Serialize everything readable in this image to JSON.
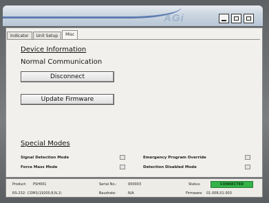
{
  "window": {
    "logo": "AGi",
    "controls": [
      "minimize",
      "restore",
      "close"
    ]
  },
  "tabs": [
    {
      "label": "Indicator",
      "active": false
    },
    {
      "label": "Unit Setup",
      "active": false
    },
    {
      "label": "Misc",
      "active": true
    }
  ],
  "device_info": {
    "heading": "Device Information",
    "status": "Normal Communication",
    "disconnect_label": "Disconnect",
    "update_label": "Update Firmware"
  },
  "special_modes": {
    "heading": "Special Modes",
    "items": [
      {
        "label": "Signal Detection Mode",
        "checked": false
      },
      {
        "label": "Emergency Program Override",
        "checked": false
      },
      {
        "label": "Force Mass Mode",
        "checked": false
      },
      {
        "label": "Detection Disabled Mode",
        "checked": false
      }
    ]
  },
  "footer": {
    "product_label": "Product:",
    "product_value": "PSH001",
    "serial_label": "Serial No.:",
    "serial_value": "000003",
    "status_label": "Status:",
    "status_value": "CONNECTED",
    "status_color": "#34b34a",
    "port_label": "RS-232:",
    "port_value": "COM1(19200,8,N,1)",
    "baud_label": "Baudrate:",
    "baud_value": "N/A",
    "firmware_label": "Firmware:",
    "firmware_value": "01.00R,01.003"
  }
}
